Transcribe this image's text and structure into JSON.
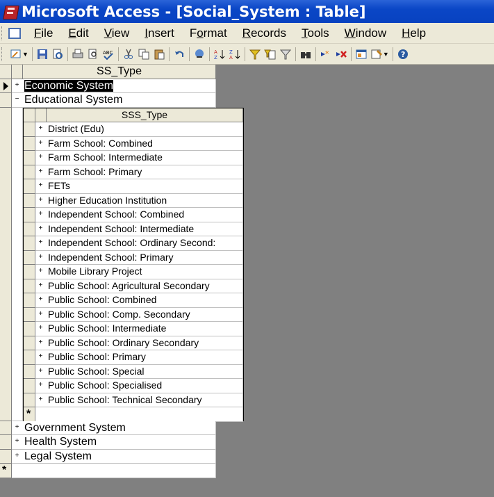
{
  "window": {
    "title": "Microsoft Access - [Social_System : Table]"
  },
  "menu": [
    "File",
    "Edit",
    "View",
    "Insert",
    "Format",
    "Records",
    "Tools",
    "Window",
    "Help"
  ],
  "menu_mnemonics": [
    "F",
    "E",
    "V",
    "I",
    "o",
    "R",
    "T",
    "W",
    "H"
  ],
  "table": {
    "column": "SS_Type",
    "rows_before": [
      "Economic System",
      "Educational System"
    ],
    "rows_after": [
      "Government System",
      "Health System",
      "Legal System"
    ],
    "new_row_marker": "*"
  },
  "subtable": {
    "column": "SSS_Type",
    "rows": [
      "District (Edu)",
      "Farm School: Combined",
      "Farm School: Intermediate",
      "Farm School: Primary",
      "FETs",
      "Higher Education Institution",
      "Independent School: Combined",
      "Independent School: Intermediate",
      "Independent School: Ordinary Second:",
      "Independent School: Primary",
      "Mobile Library Project",
      "Public School: Agricultural Secondary",
      "Public School: Combined",
      "Public School: Comp. Secondary",
      "Public School: Intermediate",
      "Public School: Ordinary Secondary",
      "Public School: Primary",
      "Public School: Special",
      "Public School: Specialised",
      "Public School: Technical Secondary"
    ],
    "new_row_marker": "*"
  },
  "colors": {
    "titlebar": "#0a46c6",
    "face": "#ece9d8",
    "workspace": "#808080"
  }
}
